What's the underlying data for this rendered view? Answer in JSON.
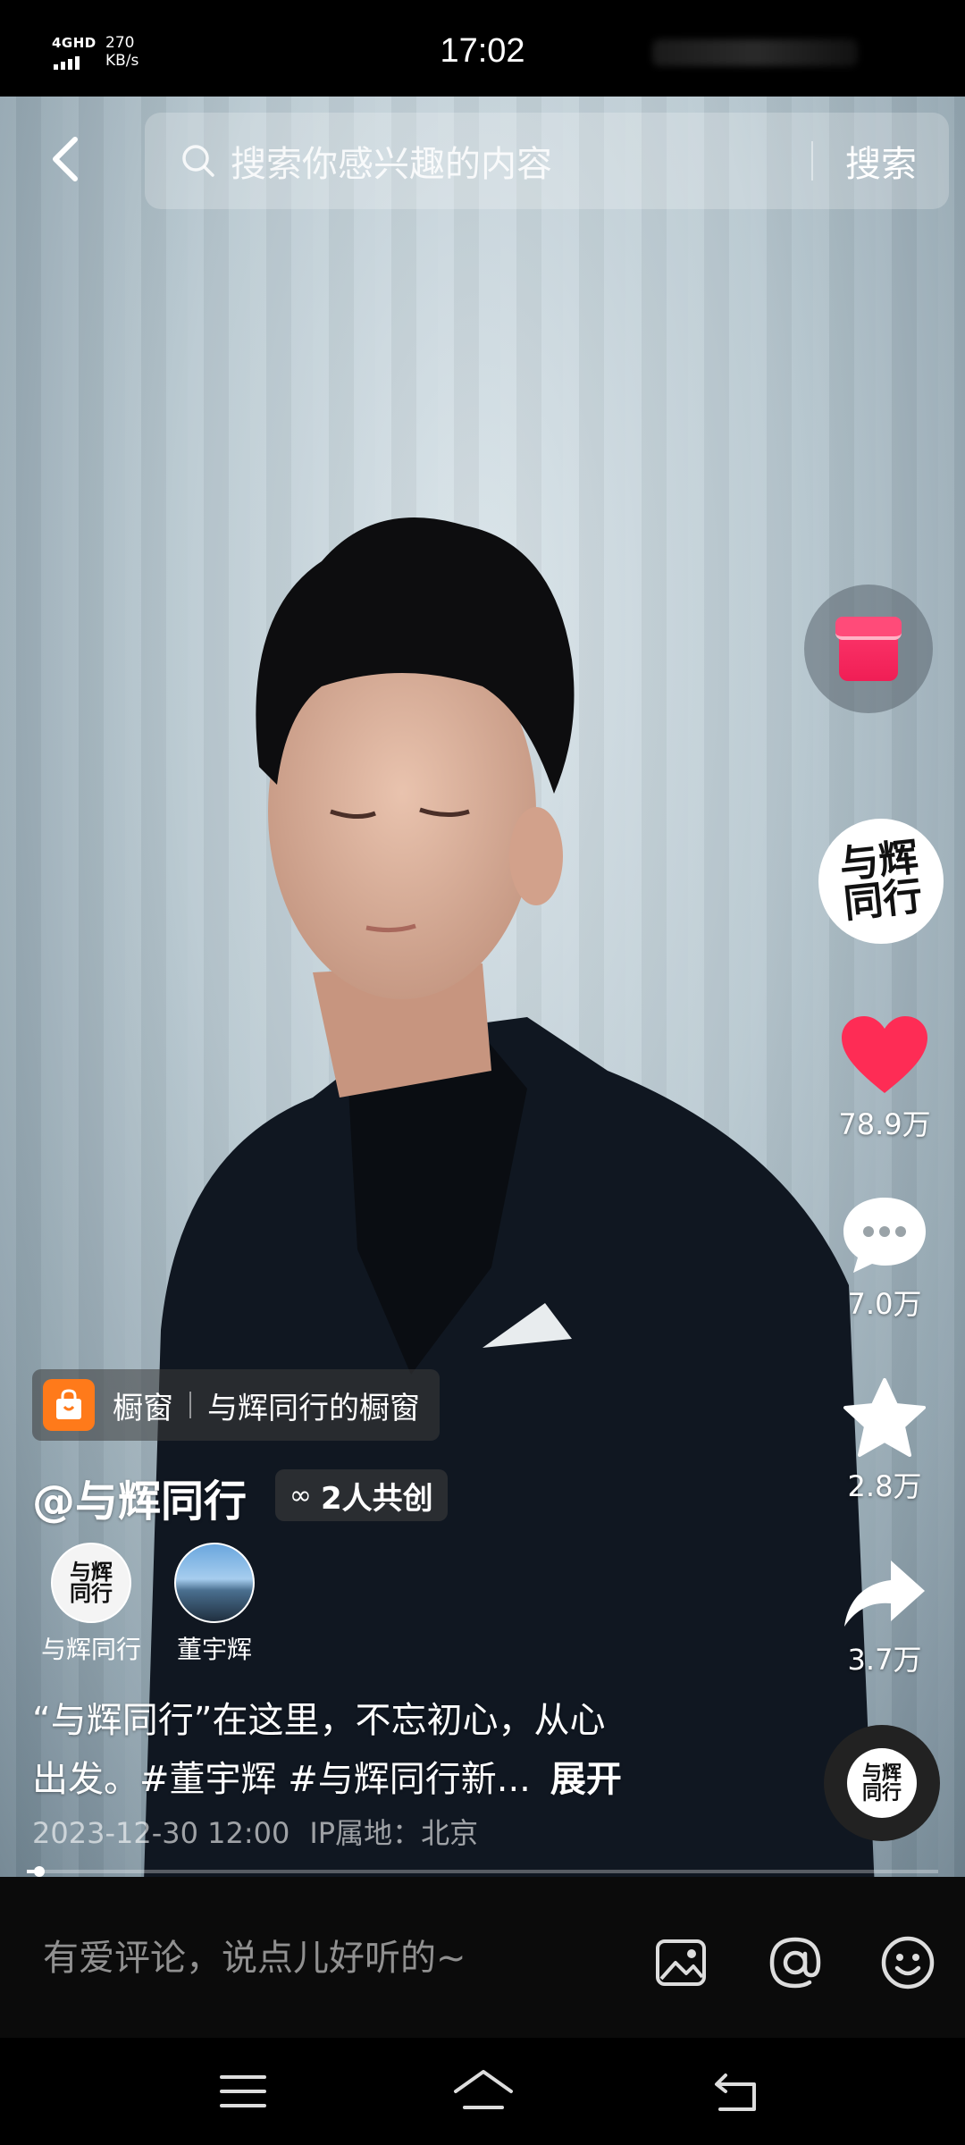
{
  "status_bar": {
    "network": "4GHD",
    "speed_value": "270",
    "speed_unit": "KB/s",
    "time": "17:02"
  },
  "search": {
    "placeholder": "搜索你感兴趣的内容",
    "button_label": "搜索"
  },
  "rail": {
    "likes": "78.9万",
    "comments": "7.0万",
    "favorites": "2.8万",
    "shares": "3.7万",
    "avatar_text": "与辉同行"
  },
  "shop": {
    "label": "橱窗",
    "store_name": "与辉同行的橱窗"
  },
  "author": {
    "handle": "@与辉同行",
    "cocreate_label": "2人共创"
  },
  "co_creators": [
    {
      "name": "与辉同行",
      "avatar_text": "与辉同行"
    },
    {
      "name": "董宇辉"
    }
  ],
  "caption": {
    "line1": "“与辉同行”在这里，不忘初心，从心",
    "line2": "出发。#董宇辉 #与辉同行新...",
    "more": "展开"
  },
  "meta": {
    "datetime": "2023-12-30 12:00",
    "ip_location": "IP属地：北京"
  },
  "progress": {
    "played_fraction": 0.01
  },
  "comment_bar": {
    "placeholder": "有爱评论，说点儿好听的~"
  },
  "icons": {
    "back": "chevron-left-icon",
    "search": "search-icon",
    "like": "heart-icon",
    "comment": "comment-bubble-icon",
    "favorite": "star-icon",
    "share": "share-arrow-icon",
    "image": "image-icon",
    "mention": "at-icon",
    "emoji": "emoji-icon"
  },
  "colors": {
    "like": "#fe2c55",
    "shop_icon": "#ff7a1a",
    "gift": "#f01e55"
  }
}
